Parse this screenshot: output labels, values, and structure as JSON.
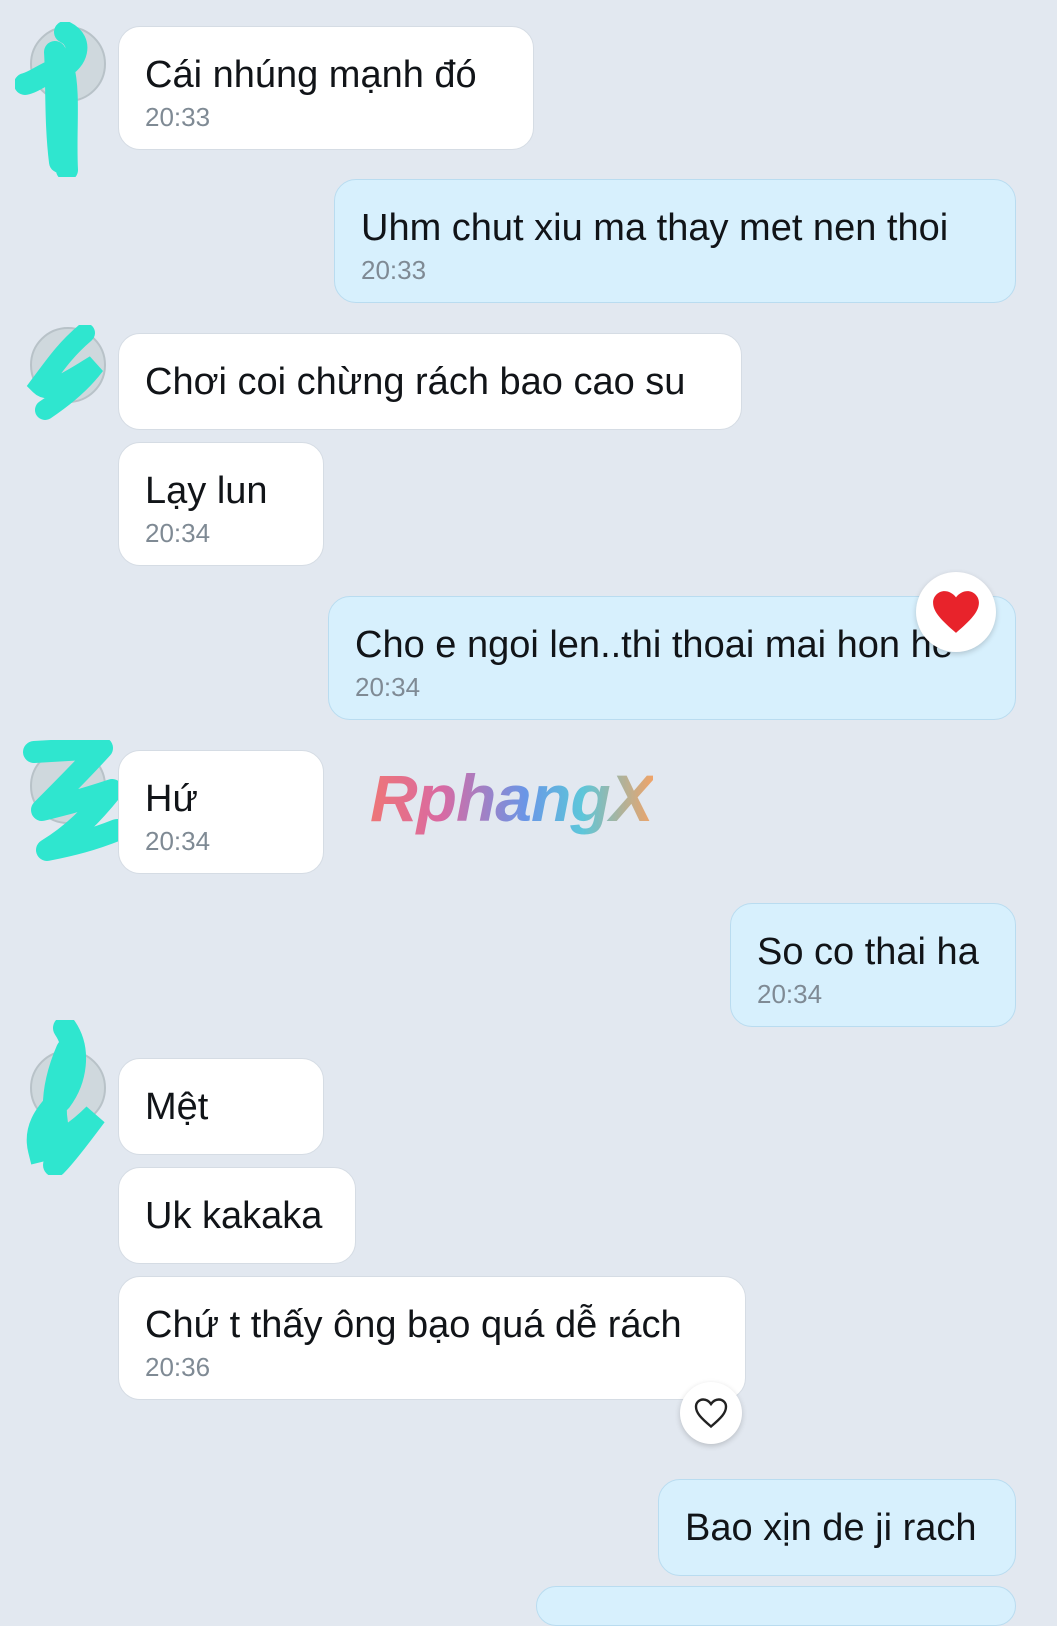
{
  "messages": [
    {
      "side": "in",
      "text": "Cái nhúng mạnh đó",
      "time": "20:33"
    },
    {
      "side": "out",
      "text": "Uhm chut xiu ma thay met nen thoi",
      "time": "20:33"
    },
    {
      "side": "in",
      "text": "Chơi coi chừng rách bao cao su",
      "time": ""
    },
    {
      "side": "in",
      "text": "Lạy lun",
      "time": "20:34"
    },
    {
      "side": "out",
      "text": "Cho e ngoi len..thi thoai mai hon he",
      "time": "20:34",
      "reaction": "heart-filled"
    },
    {
      "side": "in",
      "text": "Hứ",
      "time": "20:34"
    },
    {
      "side": "out",
      "text": "So co thai ha",
      "time": "20:34"
    },
    {
      "side": "in",
      "text": "Mệt",
      "time": ""
    },
    {
      "side": "in",
      "text": "Uk kakaka",
      "time": ""
    },
    {
      "side": "in",
      "text": "Chứ t thấy ông bạo quá dễ rách",
      "time": "20:36",
      "reaction": "heart-outline"
    },
    {
      "side": "out",
      "text": "Bao xịn de ji rach",
      "time": ""
    }
  ],
  "watermark": "RphangX",
  "colors": {
    "background": "#e2e8f0",
    "incoming_bubble": "#ffffff",
    "outgoing_bubble": "#d7f0fd",
    "timestamp": "#7f8a94",
    "censor_scribble": "#2fe6cf",
    "heart": "#e8232b"
  }
}
